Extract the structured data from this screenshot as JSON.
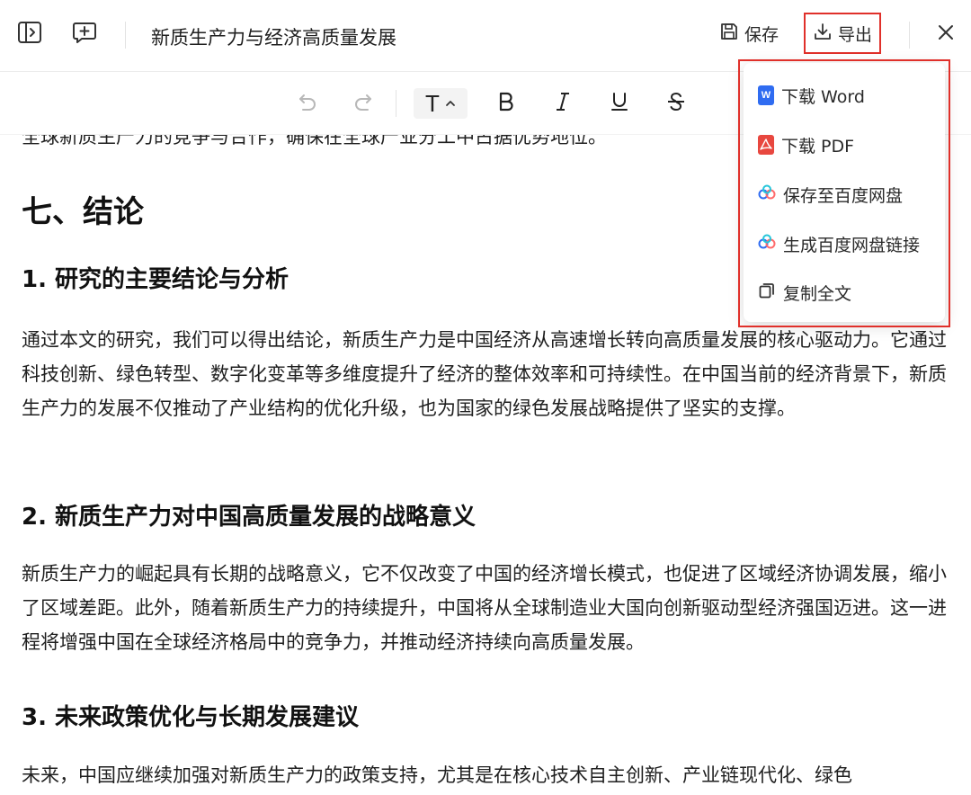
{
  "header": {
    "title": "新质生产力与经济高质量发展",
    "save_label": "保存",
    "export_label": "导出"
  },
  "icons": {
    "sidebar_toggle": "panel-toggle-icon",
    "comment": "comment-add-icon",
    "close": "close-icon"
  },
  "toolbar": {
    "text_style_label": "T"
  },
  "content": {
    "cut_line": "全球新质生产力的竞争与合作，确保在全球产业分工中占据优势地位。",
    "section_title": "七、结论",
    "subsections": [
      {
        "heading": "1. 研究的主要结论与分析",
        "paragraph": "通过本文的研究，我们可以得出结论，新质生产力是中国经济从高速增长转向高质量发展的核心驱动力。它通过科技创新、绿色转型、数字化变革等多维度提升了经济的整体效率和可持续性。在中国当前的经济背景下，新质生产力的发展不仅推动了产业结构的优化升级，也为国家的绿色发展战略提供了坚实的支撑。"
      },
      {
        "heading": "2. 新质生产力对中国高质量发展的战略意义",
        "paragraph": "新质生产力的崛起具有长期的战略意义，它不仅改变了中国的经济增长模式，也促进了区域经济协调发展，缩小了区域差距。此外，随着新质生产力的持续提升，中国将从全球制造业大国向创新驱动型经济强国迈进。这一进程将增强中国在全球经济格局中的竞争力，并推动经济持续向高质量发展。"
      },
      {
        "heading": "3. 未来政策优化与长期发展建议",
        "paragraph": "未来，中国应继续加强对新质生产力的政策支持，尤其是在核心技术自主创新、产业链现代化、绿色"
      }
    ]
  },
  "export_menu": {
    "items": [
      {
        "label": "下载 Word",
        "icon": "word-icon"
      },
      {
        "label": "下载 PDF",
        "icon": "pdf-icon"
      },
      {
        "label": "保存至百度网盘",
        "icon": "baidu-netdisk-icon"
      },
      {
        "label": "生成百度网盘链接",
        "icon": "baidu-netdisk-link-icon"
      },
      {
        "label": "复制全文",
        "icon": "copy-icon"
      }
    ]
  },
  "colors": {
    "highlight_border": "#e0302a",
    "word_blue": "#2f6cf1",
    "pdf_red": "#e8473f"
  }
}
